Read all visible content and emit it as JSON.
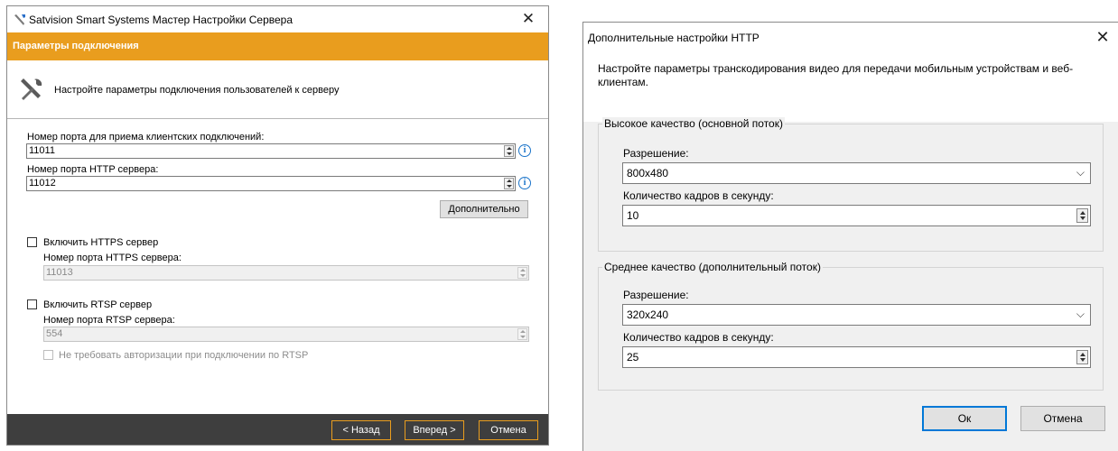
{
  "wizard": {
    "title": "Satvision Smart Systems Мастер Настройки Сервера",
    "close_glyph": "✕",
    "banner": "Параметры подключения",
    "description": "Настройте параметры подключения пользователей к серверу",
    "client_port_label": "Номер порта для приема клиентских подключений:",
    "client_port_value": "11011",
    "http_port_label": "Номер порта HTTP сервера:",
    "http_port_value": "11012",
    "advanced_button": "Дополнительно",
    "https_checkbox_label": "Включить HTTPS сервер",
    "https_port_label": "Номер порта HTTPS сервера:",
    "https_port_value": "11013",
    "rtsp_checkbox_label": "Включить RTSP сервер",
    "rtsp_port_label": "Номер порта RTSP сервера:",
    "rtsp_port_value": "554",
    "rtsp_noauth_label": "Не требовать авторизации при подключении по RTSP",
    "back_button": "< Назад",
    "next_button": "Вперед >",
    "cancel_button": "Отмена",
    "info_glyph": "i",
    "colors": {
      "banner": "#e99d1e",
      "footer": "#3e3e3e"
    }
  },
  "http_dialog": {
    "title": "Дополнительные настройки HTTP",
    "close_glyph": "✕",
    "description": "Настройте параметры транскодирования видео для передачи мобильным устройствам и веб-клиентам.",
    "high_group_title": "Высокое качество (основной поток)",
    "high_resolution_label": "Разрешение:",
    "high_resolution_value": "800x480",
    "high_fps_label": "Количество кадров в секунду:",
    "high_fps_value": "10",
    "medium_group_title": "Среднее качество (дополнительный поток)",
    "medium_resolution_label": "Разрешение:",
    "medium_resolution_value": "320x240",
    "medium_fps_label": "Количество кадров в секунду:",
    "medium_fps_value": "25",
    "ok_button": "Ок",
    "cancel_button": "Отмена",
    "chevron_glyph": "⌵",
    "colors": {
      "default_button_border": "#0078d7"
    }
  }
}
